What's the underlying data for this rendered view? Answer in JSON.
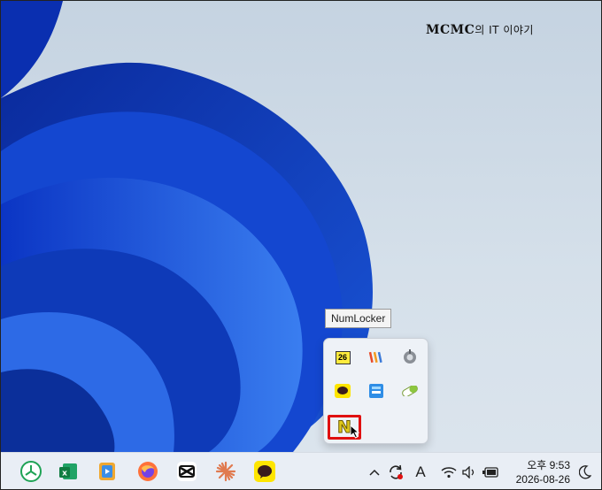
{
  "watermark": {
    "brand": "MCMC",
    "suffix": "의 IT 이야기"
  },
  "tooltip": {
    "text": "NumLocker"
  },
  "tray_popup": {
    "calendar_day": "26",
    "numlocker_glyph": "N",
    "icons": [
      "calendar-icon",
      "paint-app-icon",
      "gear-app-icon",
      "kakaotalk-tray-icon",
      "blue-app-icon",
      "pill-app-icon",
      "numlocker-icon"
    ]
  },
  "taskbar": {
    "apps": [
      "naver-whale-icon",
      "excel-icon",
      "media-player-icon",
      "firefox-icon",
      "capcut-icon",
      "claude-icon",
      "kakaotalk-icon"
    ],
    "system": {
      "input_indicator": "A",
      "chevron": "^"
    },
    "clock": {
      "time": "오후 9:53",
      "date": "2026-08-26"
    }
  },
  "colors": {
    "highlight": "#e01010",
    "tray_bg": "#eef2f7",
    "taskbar_bg": "#e9eef5"
  }
}
